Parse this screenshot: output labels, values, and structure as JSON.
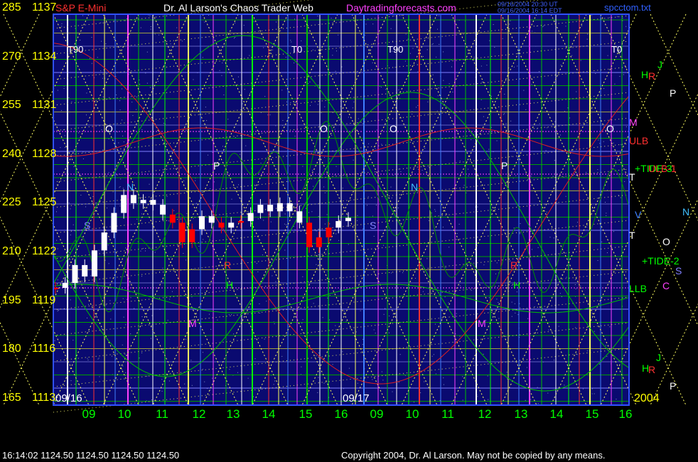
{
  "header": {
    "instrument": "S&P E-Mini",
    "title": "Dr. Al Larson's Chaos Trader Web",
    "site": "Daytradingforecasts.com",
    "timestamp_1": "09/16/2004 20:30 UT",
    "timestamp_2": "09/16/2004 16:14 EDT",
    "file": "spcctom.txt"
  },
  "footer": {
    "quote": "16:14:02  1124.50 1124.50 1124.50 1124.50",
    "copyright": "Copyright 2004, Dr. Al Larson. May not be copied by any means."
  },
  "colors": {
    "background": "#000000",
    "plot_bg": "#0a0a70",
    "axis_yellow": "#ffff00",
    "time_green": "#00ff00",
    "price_white": "#ffffff",
    "price_red": "#ff0000",
    "flux_green": "#00c000",
    "flux_red": "#e02020",
    "magenta": "#ff40ff",
    "grid_yellow": "#ffff60"
  },
  "chart_data": {
    "type": "candlestick",
    "y_axis_left_labels": [
      {
        "cycle": "285",
        "price": "1137"
      },
      {
        "cycle": "270",
        "price": "1134"
      },
      {
        "cycle": "255",
        "price": "1131"
      },
      {
        "cycle": "240",
        "price": "1128"
      },
      {
        "cycle": "225",
        "price": "1125"
      },
      {
        "cycle": "210",
        "price": "1122"
      },
      {
        "cycle": "195",
        "price": "1119"
      },
      {
        "cycle": "180",
        "price": "1116"
      },
      {
        "cycle": "165",
        "price": "1113"
      }
    ],
    "ylim": [
      1113,
      1137
    ],
    "hour_ticks": [
      "09",
      "10",
      "11",
      "12",
      "13",
      "14",
      "15",
      "16",
      "09",
      "10",
      "11",
      "12",
      "13",
      "14",
      "15",
      "16"
    ],
    "dates": [
      "09/16",
      "09/17"
    ],
    "year": "2004",
    "tide_markers": [
      "T90",
      "T0",
      "T90",
      "T0"
    ],
    "right_labels": [
      {
        "text": "J",
        "color": "#00ff00"
      },
      {
        "text": "H",
        "color": "#00ff00"
      },
      {
        "text": "R",
        "color": "#ff3030"
      },
      {
        "text": "P",
        "color": "#ffffff"
      },
      {
        "text": "M",
        "color": "#ff40ff"
      },
      {
        "text": "ULB",
        "color": "#ff3030"
      },
      {
        "text": "+TIDE-3",
        "color": "#00ff00"
      },
      {
        "text": "ULB-1",
        "color": "#ff3030"
      },
      {
        "text": "T",
        "color": "#ffffff"
      },
      {
        "text": "V",
        "color": "#4080ff"
      },
      {
        "text": "N",
        "color": "#40c0ff"
      },
      {
        "text": "T",
        "color": "#ffffff"
      },
      {
        "text": "O",
        "color": "#ffffff"
      },
      {
        "text": "+TIDE-2",
        "color": "#00ff00"
      },
      {
        "text": "S",
        "color": "#8080ff"
      },
      {
        "text": "C",
        "color": "#ff40ff"
      },
      {
        "text": "LLB",
        "color": "#00ff00"
      },
      {
        "text": "J",
        "color": "#00ff00"
      },
      {
        "text": "H",
        "color": "#00ff00"
      },
      {
        "text": "R",
        "color": "#ff3030"
      },
      {
        "text": "P",
        "color": "#ffffff"
      }
    ],
    "in_plot_labels": [
      "O",
      "N",
      "P",
      "S",
      "R",
      "H",
      "M",
      "O",
      "O",
      "N",
      "P",
      "S",
      "R",
      "H",
      "M",
      "O"
    ],
    "price_series_1116": [
      {
        "time": "08:30",
        "close": 1120.2,
        "color": "red"
      },
      {
        "time": "09:00",
        "close": 1120.5,
        "color": "white"
      },
      {
        "time": "09:15",
        "close": 1121.6,
        "color": "white"
      },
      {
        "time": "09:30",
        "close": 1120.9,
        "color": "white"
      },
      {
        "time": "09:45",
        "close": 1122.5,
        "color": "white"
      },
      {
        "time": "10:00",
        "close": 1123.6,
        "color": "white"
      },
      {
        "time": "10:15",
        "close": 1124.8,
        "color": "white"
      },
      {
        "time": "10:30",
        "close": 1125.9,
        "color": "white"
      },
      {
        "time": "10:45",
        "close": 1125.4,
        "color": "white"
      },
      {
        "time": "11:00",
        "close": 1125.6,
        "color": "white"
      },
      {
        "time": "11:15",
        "close": 1125.3,
        "color": "white"
      },
      {
        "time": "11:30",
        "close": 1124.7,
        "color": "white"
      },
      {
        "time": "11:45",
        "close": 1124.2,
        "color": "red"
      },
      {
        "time": "12:00",
        "close": 1123.0,
        "color": "red"
      },
      {
        "time": "12:15",
        "close": 1123.8,
        "color": "red"
      },
      {
        "time": "12:30",
        "close": 1124.6,
        "color": "white"
      },
      {
        "time": "12:45",
        "close": 1124.2,
        "color": "white"
      },
      {
        "time": "13:00",
        "close": 1123.9,
        "color": "red"
      },
      {
        "time": "13:15",
        "close": 1124.2,
        "color": "white"
      },
      {
        "time": "13:30",
        "close": 1124.3,
        "color": "red"
      },
      {
        "time": "13:45",
        "close": 1124.8,
        "color": "white"
      },
      {
        "time": "14:00",
        "close": 1125.3,
        "color": "white"
      },
      {
        "time": "14:15",
        "close": 1124.9,
        "color": "white"
      },
      {
        "time": "14:30",
        "close": 1125.4,
        "color": "white"
      },
      {
        "time": "14:45",
        "close": 1124.9,
        "color": "white"
      },
      {
        "time": "15:00",
        "close": 1124.2,
        "color": "white"
      },
      {
        "time": "15:15",
        "close": 1122.7,
        "color": "red"
      },
      {
        "time": "15:30",
        "close": 1123.3,
        "color": "red"
      },
      {
        "time": "15:45",
        "close": 1123.9,
        "color": "red"
      },
      {
        "time": "16:00",
        "close": 1124.3,
        "color": "white"
      },
      {
        "time": "16:14",
        "close": 1124.5,
        "color": "white"
      }
    ]
  }
}
